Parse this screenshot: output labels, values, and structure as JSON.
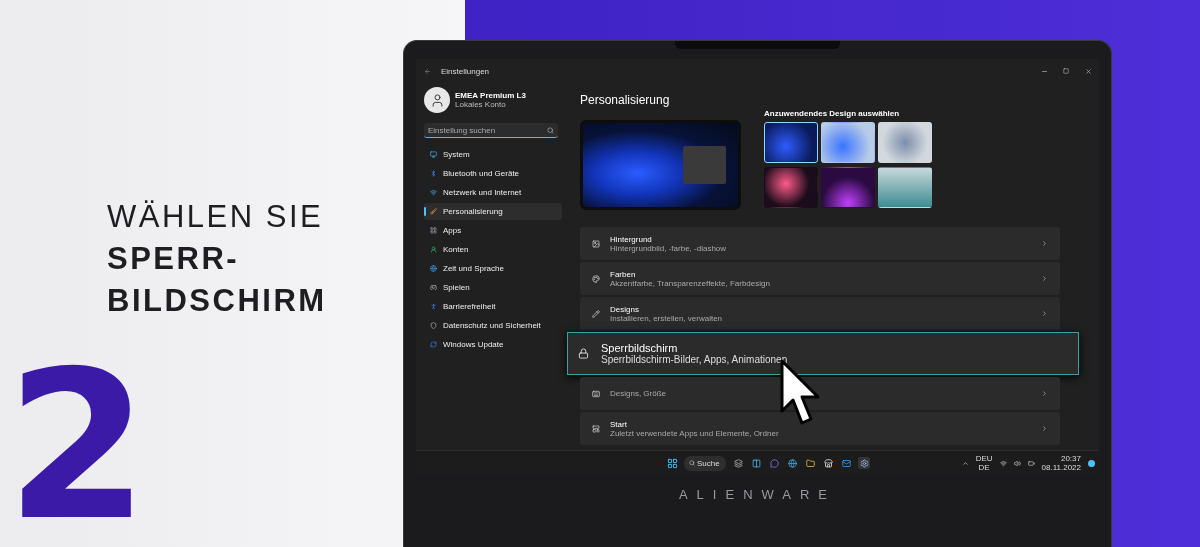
{
  "headline": {
    "lines": [
      {
        "text": "WÄHLEN SIE",
        "bold": false
      },
      {
        "text": "SPERR-",
        "bold": true
      },
      {
        "text": "BILDSCHIRM",
        "bold": true
      }
    ]
  },
  "step_number": "2",
  "laptop_brand": "ALIENWARE",
  "window": {
    "title": "Einstellungen"
  },
  "account": {
    "name": "EMEA Premium L3",
    "type": "Lokales Konto"
  },
  "search": {
    "placeholder": "Einstellung suchen"
  },
  "sidebar": {
    "items": [
      {
        "label": "System",
        "selected": false
      },
      {
        "label": "Bluetooth und Geräte",
        "selected": false
      },
      {
        "label": "Netzwerk und Internet",
        "selected": false
      },
      {
        "label": "Personalisierung",
        "selected": true
      },
      {
        "label": "Apps",
        "selected": false
      },
      {
        "label": "Konten",
        "selected": false
      },
      {
        "label": "Zeit und Sprache",
        "selected": false
      },
      {
        "label": "Spielen",
        "selected": false
      },
      {
        "label": "Barrierefreiheit",
        "selected": false
      },
      {
        "label": "Datenschutz und Sicherheit",
        "selected": false
      },
      {
        "label": "Windows Update",
        "selected": false
      }
    ]
  },
  "page_title": "Personalisierung",
  "themes": {
    "label": "Anzuwendendes Design auswählen",
    "items": [
      {
        "selected": true
      },
      {
        "selected": false
      },
      {
        "selected": false
      },
      {
        "selected": false
      },
      {
        "selected": false
      },
      {
        "selected": false
      }
    ]
  },
  "settings": [
    {
      "title": "Hintergrund",
      "subtitle": "Hintergrundbild, -farbe, -diashow",
      "selected": false
    },
    {
      "title": "Farben",
      "subtitle": "Akzentfarbe, Transparenzeffekte, Farbdesign",
      "selected": false
    },
    {
      "title": "Designs",
      "subtitle": "Installieren, erstellen, verwalten",
      "selected": false
    },
    {
      "title": "Sperrbildschirm",
      "subtitle": "Sperrbildschirm-Bilder, Apps, Animationen",
      "selected": true
    },
    {
      "subtitle": "Designs, Größe",
      "selected": false
    },
    {
      "title": "Start",
      "subtitle": "Zuletzt verwendete Apps und Elemente, Ordner",
      "selected": false
    }
  ],
  "taskbar": {
    "search_label": "Suche",
    "language": "DEU",
    "layout": "DE",
    "time": "20:37",
    "date": "08.11.2022"
  }
}
